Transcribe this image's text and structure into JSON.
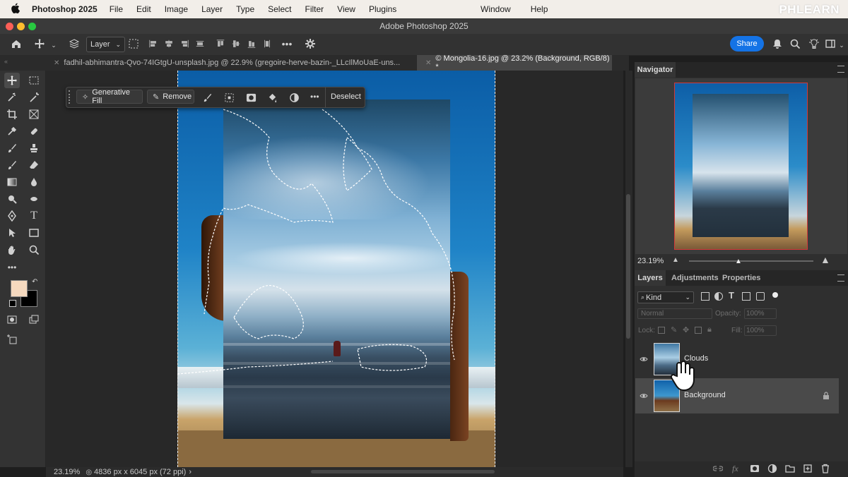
{
  "menubar": {
    "app_name": "Photoshop 2025",
    "items": [
      "File",
      "Edit",
      "Image",
      "Layer",
      "Type",
      "Select",
      "Filter",
      "View",
      "Plugins"
    ],
    "right_items": [
      "Window",
      "Help"
    ],
    "logo": "PHLEARN"
  },
  "window": {
    "title": "Adobe Photoshop 2025"
  },
  "options_bar": {
    "layer_select": "Layer",
    "share_label": "Share"
  },
  "tabs": [
    {
      "label": "fadhil-abhimantra-Qvo-74IGtgU-unsplash.jpg @ 22.9% (gregoire-herve-bazin-_LLcIlMoUaE-uns...",
      "active": false
    },
    {
      "label": "© Mongolia-16.jpg @ 23.2% (Background, RGB/8) *",
      "active": true
    }
  ],
  "context_bar": {
    "generative_fill": "Generative Fill",
    "remove": "Remove",
    "more": "•••",
    "deselect": "Deselect"
  },
  "status": {
    "zoom": "23.19%",
    "dims": "4836 px x 6045 px (72 ppi)",
    "arrow": "›"
  },
  "colors": {
    "foreground": "#f5d9bf",
    "background": "#000000",
    "accent": "#1473e6"
  },
  "navigator": {
    "title": "Navigator",
    "zoom": "23.19%"
  },
  "layers_panel": {
    "tabs": [
      "Layers",
      "Adjustments",
      "Properties"
    ],
    "kind": "Kind",
    "blend_mode": "Normal",
    "opacity_label": "Opacity:",
    "opacity_value": "100%",
    "lock_label": "Lock:",
    "fill_label": "Fill:",
    "fill_value": "100%",
    "layers": [
      {
        "name": "Clouds",
        "locked": false
      },
      {
        "name": "Background",
        "locked": true
      }
    ]
  },
  "panel_icons": [
    "link-icon",
    "fx-icon",
    "mask-icon",
    "adjustment-icon",
    "folder-icon",
    "new-layer-icon",
    "trash-icon"
  ]
}
